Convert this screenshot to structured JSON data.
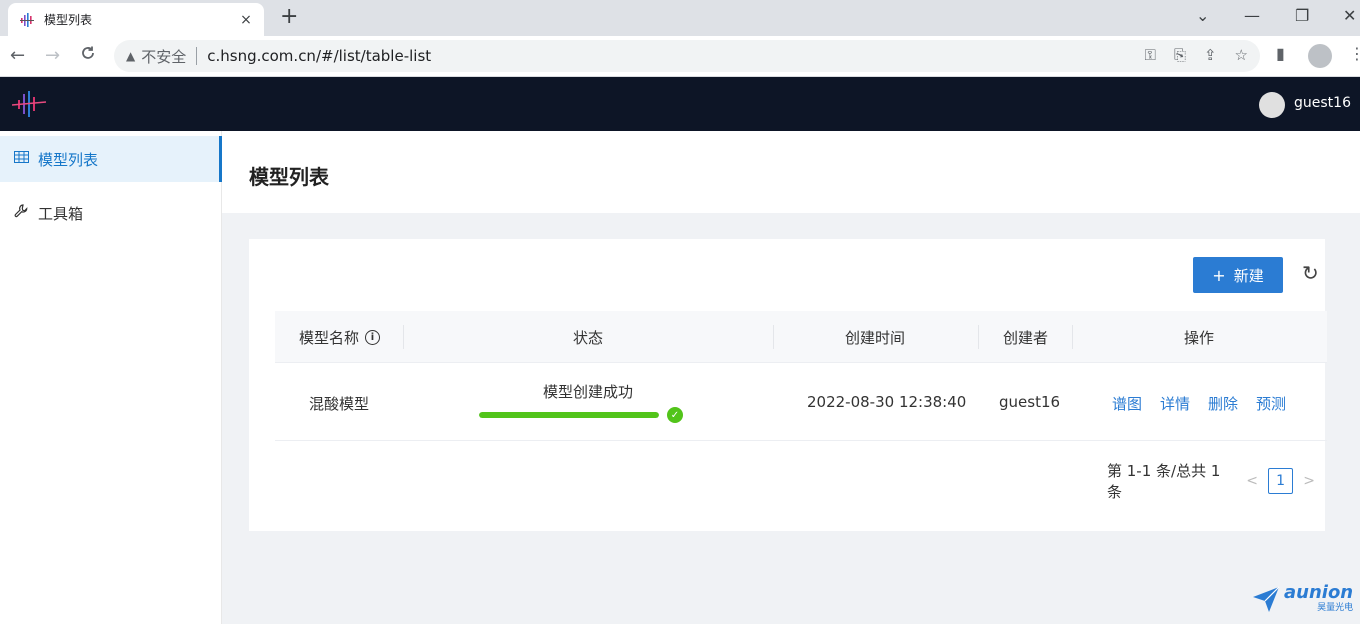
{
  "browser": {
    "tab_title": "模型列表",
    "tab_close": "×",
    "new_tab": "+",
    "window_controls": {
      "collapse": "⌄",
      "minimize": "—",
      "restore": "❐",
      "close": "✕"
    },
    "nav": {
      "back": "←",
      "forward": "→",
      "reload": "C"
    },
    "security_warning": "不安全",
    "url": "c.hsng.com.cn/#/list/table-list",
    "icons": [
      "key-icon",
      "translate-icon",
      "share-icon",
      "star-icon",
      "side-panel-icon",
      "profile-icon",
      "menu-dots-icon"
    ]
  },
  "header": {
    "user_name": "guest16",
    "colors": {
      "bg": "#0d1526"
    }
  },
  "sidebar": {
    "items": [
      {
        "label": "模型列表",
        "icon": "table-icon",
        "active": true
      },
      {
        "label": "工具箱",
        "icon": "wrench-icon",
        "active": false
      }
    ]
  },
  "page": {
    "title": "模型列表"
  },
  "toolbar": {
    "new_label": "新建",
    "plus": "+",
    "refresh": "↻"
  },
  "table": {
    "columns": [
      "模型名称",
      "状态",
      "创建时间",
      "创建者",
      "操作"
    ],
    "info_glyph": "i",
    "rows": [
      {
        "name": "混酸模型",
        "status": "模型创建成功",
        "progress": 1.0,
        "created_at": "2022-08-30 12:38:40",
        "creator": "guest16",
        "actions": [
          "谱图",
          "详情",
          "删除",
          "预测"
        ]
      }
    ]
  },
  "pagination": {
    "summary": "第 1-1 条/总共 1 条",
    "prev": "<",
    "next": ">",
    "current": "1"
  },
  "watermark": {
    "brand": "aunion",
    "sub": "昊量光电"
  },
  "colors": {
    "primary": "#2b7cd3",
    "success": "#52c41a",
    "active_menu_bg": "#e6f2fb"
  }
}
